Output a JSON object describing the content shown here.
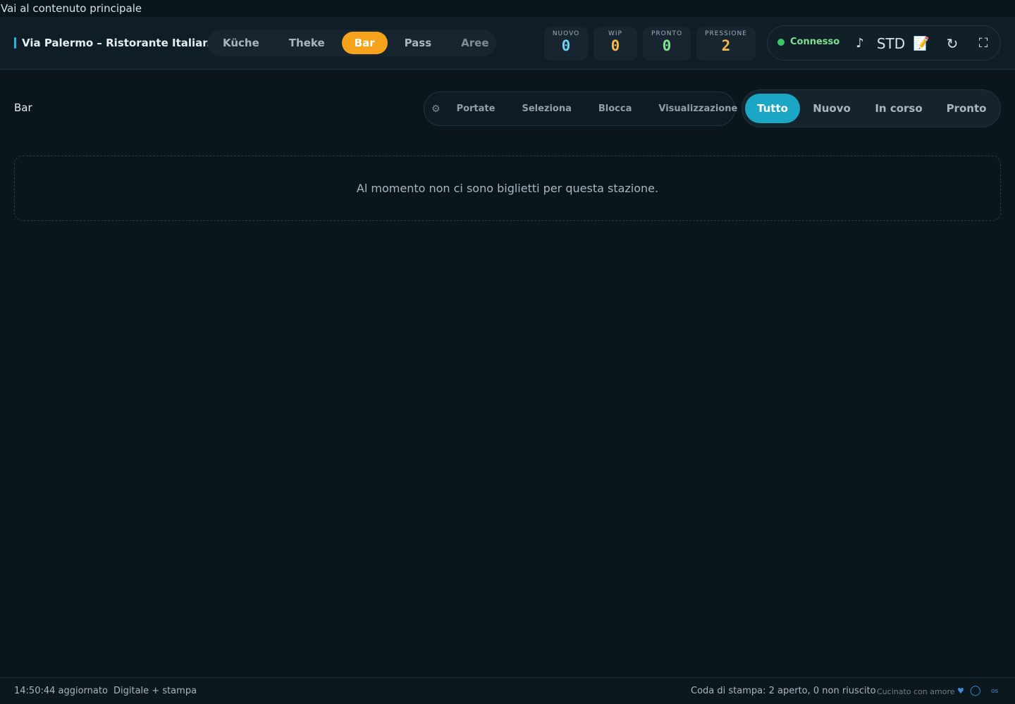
{
  "skip_link": "Vai al contenuto principale",
  "brand": {
    "title": "Via Palermo – Ristorante Italiano"
  },
  "stations": [
    {
      "label": "Küche"
    },
    {
      "label": "Theke"
    },
    {
      "label": "Bar"
    },
    {
      "label": "Pass"
    },
    {
      "label": "Aree"
    }
  ],
  "active_station": "Bar",
  "kpis": [
    {
      "label": "NUOVO",
      "value": "0",
      "color": "#6fd0f0"
    },
    {
      "label": "WIP",
      "value": "0",
      "color": "#f5b84a"
    },
    {
      "label": "PRONTO",
      "value": "0",
      "color": "#7fe08f"
    },
    {
      "label": "PRESSIONE",
      "value": "2",
      "color": "#f5b84a"
    }
  ],
  "status": {
    "connection": "Connesso",
    "sound_icon": "♪",
    "mode": "STD",
    "notes_icon": "📝",
    "refresh_icon": "↻",
    "fullscreen_icon": "⛶"
  },
  "page": {
    "title": "Bar"
  },
  "tools": {
    "gear_icon": "⚙",
    "items": [
      "Portate",
      "Seleziona",
      "Blocca",
      "Visualizzazione"
    ]
  },
  "filters": {
    "items": [
      "Tutto",
      "Nuovo",
      "In corso",
      "Pronto"
    ],
    "active": "Tutto"
  },
  "empty_message": "Al momento non ci sono biglietti per questa stazione.",
  "footer": {
    "time": "14:50:44",
    "updated": "aggiornato",
    "mode": "Digitale + stampa",
    "print_queue": "Coda di stampa: 2 aperto, 0 non riuscito",
    "made_with": "Cucinato con amore",
    "heart": "♥",
    "circle": "◯",
    "os": "os"
  },
  "colors": {
    "accent_orange": "#f7a21b",
    "accent_cyan": "#1ba6c6",
    "connected_green": "#3cc566"
  }
}
